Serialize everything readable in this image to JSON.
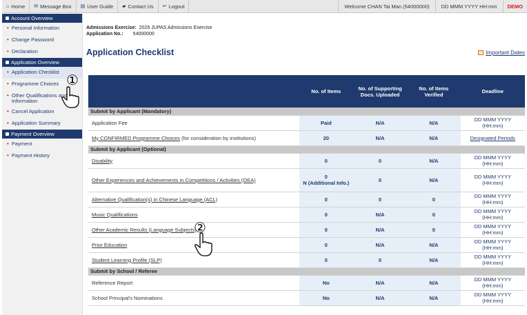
{
  "topbar": {
    "home": "Home",
    "message_box": "Message Box",
    "user_guide": "User Guide",
    "contact_us": "Contact Us",
    "logout": "Logout",
    "welcome": "Welcome CHAN Tai Man (54000000)",
    "datetime": "DD MMM YYYY HH:mm",
    "demo": "DEMO"
  },
  "sidebar": {
    "sections": [
      {
        "title": "Account Overview",
        "items": [
          "Personal Information",
          "Change Password",
          "Declaration"
        ]
      },
      {
        "title": "Application Overview",
        "items": [
          "Application Checklist",
          "Programme Choices",
          "Other Qualifications and Information",
          "Cancel Application",
          "Application Summary"
        ]
      },
      {
        "title": "Payment Overview",
        "items": [
          "Payment",
          "Payment History"
        ]
      }
    ]
  },
  "meta": {
    "exercise_label": "Admissions Exercise:",
    "exercise_value": "2026 JUPAS Admissions Exercise",
    "appno_label": "Application No.:",
    "appno_value": "54000000"
  },
  "page_title": "Application Checklist",
  "important_dates": "Important Dates",
  "table": {
    "headers": [
      "",
      "No. of Items",
      "No. of Supporting Docs. Uploaded",
      "No. of Items Verified",
      "Deadline"
    ],
    "sections": [
      {
        "title": "Submit by Applicant (Mandatory)",
        "rows": [
          {
            "item": "Application Fee",
            "link": false,
            "n": "Paid",
            "docs": "N/A",
            "verified": "N/A",
            "deadline": "DD MMM YYYY (HH:mm)"
          },
          {
            "item": "My CONFIRMED Programme Choices",
            "suffix": "(for consideration by institutions)",
            "link": true,
            "n": "20",
            "docs": "N/A",
            "verified": "N/A",
            "deadline": "Designated Periods",
            "deadline_link": true
          }
        ]
      },
      {
        "title": "Submit by Applicant (Optional)",
        "rows": [
          {
            "item": "Disability",
            "link": true,
            "n": "0",
            "docs": "0",
            "verified": "N/A",
            "deadline": "DD MMM YYYY (HH:mm)"
          },
          {
            "item": "Other Experiences and Achievements in Competitions / Activities (OEA)",
            "link": true,
            "n": "0",
            "n2": "N (Additional Info.)",
            "docs": "0",
            "verified": "N/A",
            "deadline": "DD MMM YYYY (HH:mm)"
          },
          {
            "item": "Alternative Qualification(s) in Chinese Language (ACL)",
            "link": true,
            "n": "0",
            "docs": "0",
            "verified": "0",
            "deadline": "DD MMM YYYY (HH:mm)"
          },
          {
            "item": "Music Qualifications",
            "link": true,
            "n": "0",
            "docs": "N/A",
            "verified": "0",
            "deadline": "DD MMM YYYY (HH:mm)"
          },
          {
            "item": "Other Academic Results (Language Subjects)",
            "link": true,
            "n": "0",
            "docs": "N/A",
            "verified": "0",
            "deadline": "DD MMM YYYY (HH:mm)"
          },
          {
            "item": "Prior Education",
            "link": true,
            "n": "0",
            "docs": "N/A",
            "verified": "N/A",
            "deadline": "DD MMM YYYY (HH:mm)"
          },
          {
            "item": "Student Learning Profile (SLP)",
            "link": true,
            "n": "0",
            "docs": "0",
            "verified": "N/A",
            "deadline": "DD MMM YYYY (HH:mm)"
          }
        ]
      },
      {
        "title": "Submit by School / Referee",
        "rows": [
          {
            "item": "Reference Report",
            "link": false,
            "n": "No",
            "docs": "N/A",
            "verified": "N/A",
            "deadline": "DD MMM YYYY (HH:mm)"
          },
          {
            "item": "School Principal's Nominations",
            "link": false,
            "n": "No",
            "docs": "N/A",
            "verified": "N/A",
            "deadline": "DD MMM YYYY (HH:mm)"
          }
        ]
      }
    ]
  },
  "annotations": {
    "marker1": "①",
    "marker2": "②"
  },
  "colors": {
    "navy": "#1e3a6e",
    "accent_red": "#d9181b",
    "section_gray": "#c8c8c8",
    "cell_blue": "#e6eef7"
  }
}
